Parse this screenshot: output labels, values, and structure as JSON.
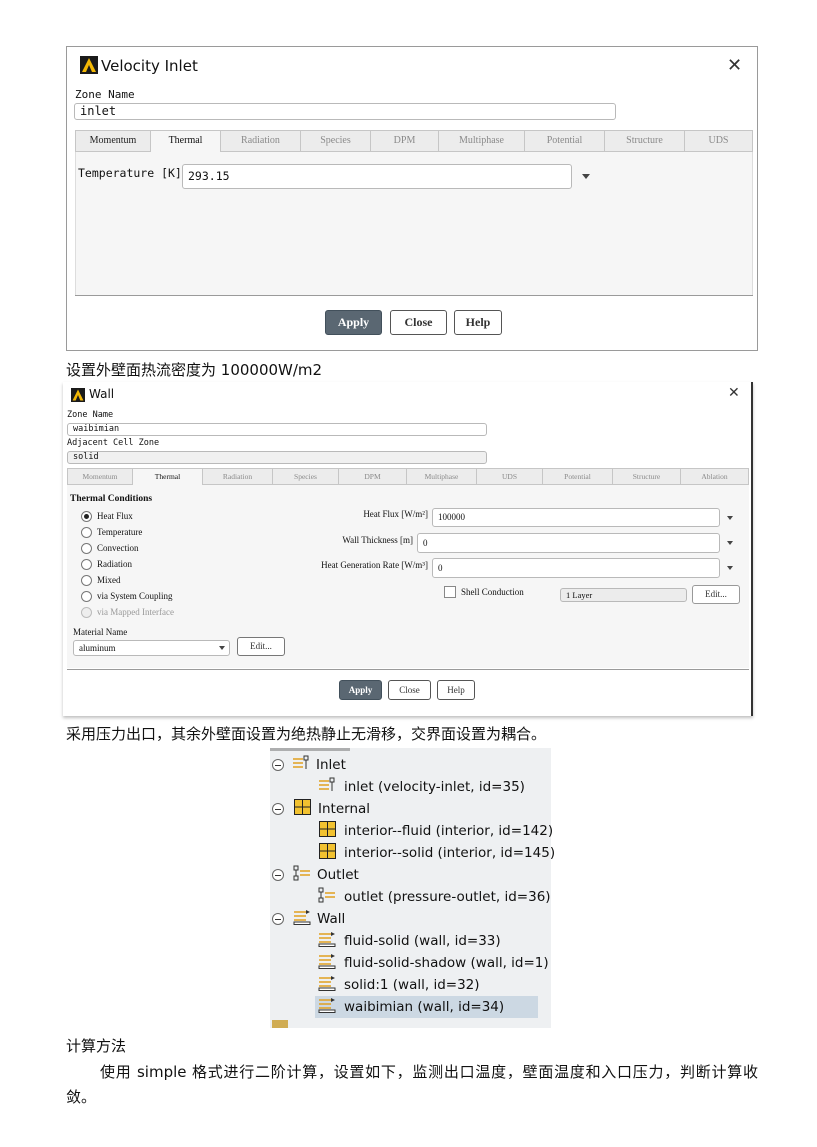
{
  "dialog1": {
    "title": "Velocity Inlet",
    "zone_name_label": "Zone Name",
    "zone_name_value": "inlet",
    "tabs": [
      "Momentum",
      "Thermal",
      "Radiation",
      "Species",
      "DPM",
      "Multiphase",
      "Potential",
      "Structure",
      "UDS"
    ],
    "active_tab": "Thermal",
    "temperature_label": "Temperature [K]",
    "temperature_value": "293.15",
    "buttons": {
      "apply": "Apply",
      "close": "Close",
      "help": "Help"
    }
  },
  "text1": "设置外壁面热流密度为 100000W/m2",
  "dialog2": {
    "title": "Wall",
    "zone_name_label": "Zone Name",
    "zone_name_value": "waibimian",
    "adjacent_label": "Adjacent Cell Zone",
    "adjacent_value": "solid",
    "tabs": [
      "Momentum",
      "Thermal",
      "Radiation",
      "Species",
      "DPM",
      "Multiphase",
      "UDS",
      "Potential",
      "Structure",
      "Ablation"
    ],
    "active_tab": "Thermal",
    "thermal_conditions_label": "Thermal Conditions",
    "radios": [
      {
        "label": "Heat Flux",
        "checked": true,
        "disabled": false
      },
      {
        "label": "Temperature",
        "checked": false,
        "disabled": false
      },
      {
        "label": "Convection",
        "checked": false,
        "disabled": false
      },
      {
        "label": "Radiation",
        "checked": false,
        "disabled": false
      },
      {
        "label": "Mixed",
        "checked": false,
        "disabled": false
      },
      {
        "label": "via System Coupling",
        "checked": false,
        "disabled": false
      },
      {
        "label": "via Mapped Interface",
        "checked": false,
        "disabled": true
      }
    ],
    "heat_flux_label": "Heat Flux [W/m²]",
    "heat_flux_value": "100000",
    "wall_thickness_label": "Wall Thickness [m]",
    "wall_thickness_value": "0",
    "heat_gen_label": "Heat Generation Rate [W/m³]",
    "heat_gen_value": "0",
    "shell_conduction_label": "Shell Conduction",
    "layer_value": "1 Layer",
    "edit_label": "Edit...",
    "material_name_label": "Material Name",
    "material_value": "aluminum",
    "buttons": {
      "apply": "Apply",
      "close": "Close",
      "help": "Help"
    }
  },
  "text2": "采用压力出口，其余外壁面设置为绝热静止无滑移，交界面设置为耦合。",
  "tree": {
    "groups": [
      {
        "label": "Inlet",
        "icon": "inlet-icon",
        "children": [
          {
            "label": "inlet (velocity-inlet, id=35)",
            "icon": "inlet-icon"
          }
        ]
      },
      {
        "label": "Internal",
        "icon": "interior-grid-icon",
        "children": [
          {
            "label": "interior--fluid (interior, id=142)",
            "icon": "interior-grid-icon"
          },
          {
            "label": "interior--solid (interior, id=145)",
            "icon": "interior-grid-icon"
          }
        ]
      },
      {
        "label": "Outlet",
        "icon": "outlet-icon",
        "children": [
          {
            "label": "outlet (pressure-outlet, id=36)",
            "icon": "outlet-icon"
          }
        ]
      },
      {
        "label": "Wall",
        "icon": "wall-icon",
        "children": [
          {
            "label": "fluid-solid (wall, id=33)",
            "icon": "wall-icon"
          },
          {
            "label": "fluid-solid-shadow (wall, id=1)",
            "icon": "wall-icon"
          },
          {
            "label": "solid:1 (wall, id=32)",
            "icon": "wall-icon"
          },
          {
            "label": "waibimian (wall, id=34)",
            "icon": "wall-icon",
            "selected": true
          }
        ]
      }
    ],
    "colors": {
      "background": "#eef0f2",
      "selected": "#ccd8e3"
    }
  },
  "heading": "计算方法",
  "paragraph": "使用 simple 格式进行二阶计算，设置如下，监测出口温度，壁面温度和入口压力，判断计算收敛。"
}
